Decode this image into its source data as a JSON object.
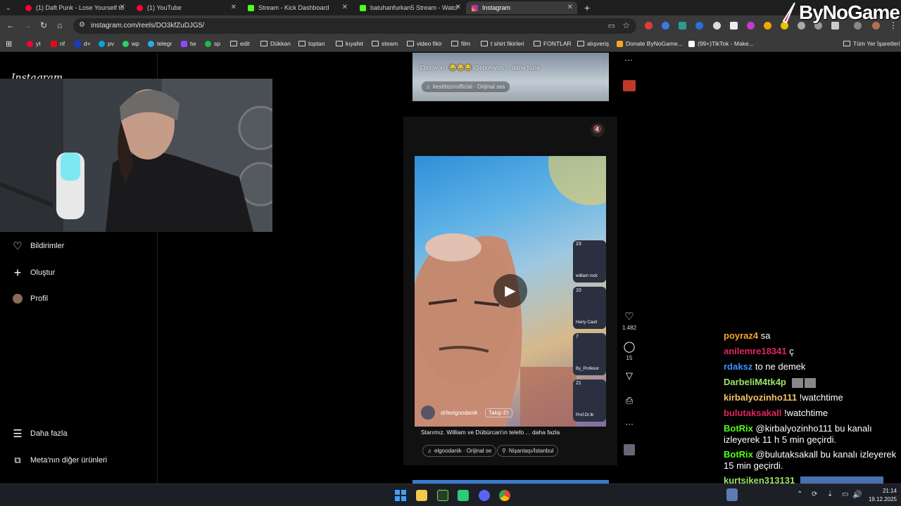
{
  "browser": {
    "tabs": [
      {
        "title": "(1) Daft Punk - Lose Yourself to",
        "favicon_color": "#ff0033"
      },
      {
        "title": "(1) YouTube",
        "favicon_color": "#ff0033"
      },
      {
        "title": "Stream - Kick Dashboard",
        "favicon_color": "#53fc18"
      },
      {
        "title": "batuhanfurkan5 Stream - Watch",
        "favicon_color": "#53fc18"
      },
      {
        "title": "Instagram",
        "favicon_color": "#e1306c"
      }
    ],
    "new_tab_label": "+",
    "url": "instagram.com/reels/DO3kfZuDJG5/",
    "bookmarks": [
      {
        "label": "yt",
        "icon": "youtube-icon",
        "color": "#ff0033"
      },
      {
        "label": "nf",
        "icon": "netflix-icon",
        "color": "#e50914"
      },
      {
        "label": "d+",
        "icon": "disney-icon",
        "color": "#113ccf"
      },
      {
        "label": "pv",
        "icon": "primevideo-icon",
        "color": "#00a8e1"
      },
      {
        "label": "wp",
        "icon": "whatsapp-icon",
        "color": "#25d366"
      },
      {
        "label": "telegr",
        "icon": "telegram-icon",
        "color": "#2aabee"
      },
      {
        "label": "tw",
        "icon": "twitch-icon",
        "color": "#9146ff"
      },
      {
        "label": "sp",
        "icon": "spotify-icon",
        "color": "#1db954"
      },
      {
        "label": "edit",
        "icon": "folder-icon"
      },
      {
        "label": "Dükkan",
        "icon": "folder-icon"
      },
      {
        "label": "toptan",
        "icon": "folder-icon"
      },
      {
        "label": "kıyafet",
        "icon": "folder-icon"
      },
      {
        "label": "steam",
        "icon": "folder-icon"
      },
      {
        "label": "video fikir",
        "icon": "folder-icon"
      },
      {
        "label": "film",
        "icon": "folder-icon"
      },
      {
        "label": "t shirt fikirleri",
        "icon": "folder-icon"
      },
      {
        "label": "FONTLAR",
        "icon": "folder-icon"
      },
      {
        "label": "alışveriş",
        "icon": "folder-icon"
      },
      {
        "label": "Donate ByNoGame...",
        "icon": "bynogame-icon",
        "color": "#f5a623"
      },
      {
        "label": "(99+)TikTok - Make...",
        "icon": "tiktok-icon",
        "color": "#ffffff"
      },
      {
        "label": "Tüm Yer İşaretleri",
        "icon": "folder-icon"
      }
    ]
  },
  "overlay": {
    "logo_text": "ByNoGame"
  },
  "instagram": {
    "logo_text": "Instagram",
    "sidebar": [
      {
        "label": "Bildirimler",
        "icon": "heart-icon"
      },
      {
        "label": "Oluştur",
        "icon": "plus-icon"
      },
      {
        "label": "Profil",
        "icon": "avatar-icon"
      },
      {
        "label": "Daha fazla",
        "icon": "menu-icon"
      },
      {
        "label": "Meta'nın diğer ürünleri",
        "icon": "meta-products-icon"
      }
    ],
    "top_reel": {
      "caption": "Ebonivon | 😂😂😂 @ebonivon ... daha fazla",
      "audio": "kesithizmofficial · Orijinal ses"
    },
    "main_reel": {
      "username": "drfeelgoodanik",
      "follow_label": "Takip Et",
      "caption": "Starımız. William ve Dübürcan'ın telefo ... daha fazla",
      "audio": "elgoodanik · Orijinal se",
      "location": "Nişantaşı/İstanbul",
      "likes": "1.482",
      "comments": "15",
      "side_counts": [
        "23",
        "10",
        "7",
        "21"
      ],
      "side_names": [
        "william rock",
        "Harry Caull",
        "By_Profesor",
        "Prof.Dr.Ib"
      ]
    }
  },
  "chat": [
    {
      "user": "poyraz4",
      "color": "#f5a623",
      "text": "sa"
    },
    {
      "user": "anilemre18341",
      "color": "#e0245e",
      "text": "ç"
    },
    {
      "user": "rdaksz",
      "color": "#3d8eff",
      "text": "to ne demek"
    },
    {
      "user": "DarbeliM4tk4p",
      "color": "#9be564",
      "text": ""
    },
    {
      "user": "kirbalyozinho111",
      "color": "#f5c26b",
      "text": "!watchtime"
    },
    {
      "user": "bulutaksakall",
      "color": "#e0245e",
      "text": "!watchtime"
    },
    {
      "user": "BotRix",
      "color": "#53fc18",
      "text": "@kirbalyozinho111 bu kanalı izleyerek 11 h 5 min geçirdi."
    },
    {
      "user": "BotRix",
      "color": "#53fc18",
      "text": "@bulutaksakall bu kanalı izleyerek 15 min geçirdi."
    },
    {
      "user": "kurtsiken313131",
      "color": "#9be564",
      "text": ""
    }
  ],
  "taskbar": {
    "time": "21:14",
    "date": "19.12.2025"
  }
}
